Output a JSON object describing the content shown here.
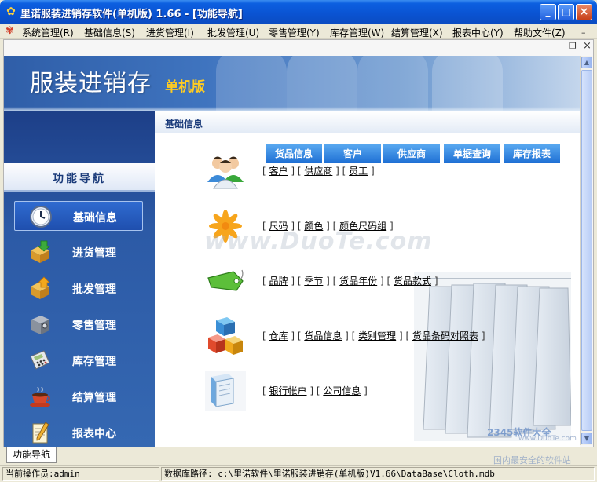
{
  "window": {
    "title": "里诺服装进销存软件(单机版) 1.66 - [功能导航]",
    "min": "_",
    "max": "□",
    "close": "×"
  },
  "menu": [
    "系统管理(R)",
    "基础信息(S)",
    "进货管理(I)",
    "批发管理(U)",
    "零售管理(Y)",
    "库存管理(W)",
    "结算管理(X)",
    "报表中心(Y)",
    "帮助文件(Z)"
  ],
  "mdi_controls": {
    "minimize": "–",
    "restore": "❐",
    "close": "×"
  },
  "banner": {
    "title": "服装进销存",
    "badge": "单机版"
  },
  "sidebar": {
    "header": "功能导航",
    "items": [
      {
        "label": "基础信息",
        "icon": "clock-icon",
        "active": true
      },
      {
        "label": "进货管理",
        "icon": "box-download-icon",
        "active": false
      },
      {
        "label": "批发管理",
        "icon": "box-upload-icon",
        "active": false
      },
      {
        "label": "零售管理",
        "icon": "safe-icon",
        "active": false
      },
      {
        "label": "库存管理",
        "icon": "calculator-icon",
        "active": false
      },
      {
        "label": "结算管理",
        "icon": "coffee-cup-icon",
        "active": false
      },
      {
        "label": "报表中心",
        "icon": "notepad-pen-icon",
        "active": false
      }
    ]
  },
  "content": {
    "header": "基础信息",
    "tabs": [
      "货品信息",
      "客户",
      "供应商",
      "单据查询",
      "库存报表"
    ],
    "rows": [
      {
        "icon": "users-icon",
        "links": [
          "客户",
          "供应商",
          "员工"
        ]
      },
      {
        "icon": "flower-icon",
        "links": [
          "尺码",
          "颜色",
          "颜色尺码组"
        ]
      },
      {
        "icon": "tag-icon",
        "links": [
          "品牌",
          "季节",
          "货品年份",
          "货品款式"
        ]
      },
      {
        "icon": "cubes-icon",
        "links": [
          "仓库",
          "货品信息",
          "类别管理",
          "货品条码对照表"
        ]
      },
      {
        "icon": "books-icon",
        "links": [
          "银行帐户",
          "公司信息"
        ]
      }
    ]
  },
  "watermark": "www.DuoTe.com",
  "bottom_tab": "功能导航",
  "status": {
    "operator": "当前操作员:admin",
    "db_path": "数据库路径: c:\\里诺软件\\里诺服装进销存(单机版)V1.66\\DataBase\\Cloth.mdb"
  },
  "corner": {
    "logo": "2345软件大全",
    "slogan": "国内最安全的软件站",
    "site": "www.DuoTe.com"
  },
  "colors": {
    "titlebar": "#0a53d2",
    "sidebar": "#2c5aa6",
    "tab": "#1e6fd4",
    "accent": "#ffcc22"
  }
}
